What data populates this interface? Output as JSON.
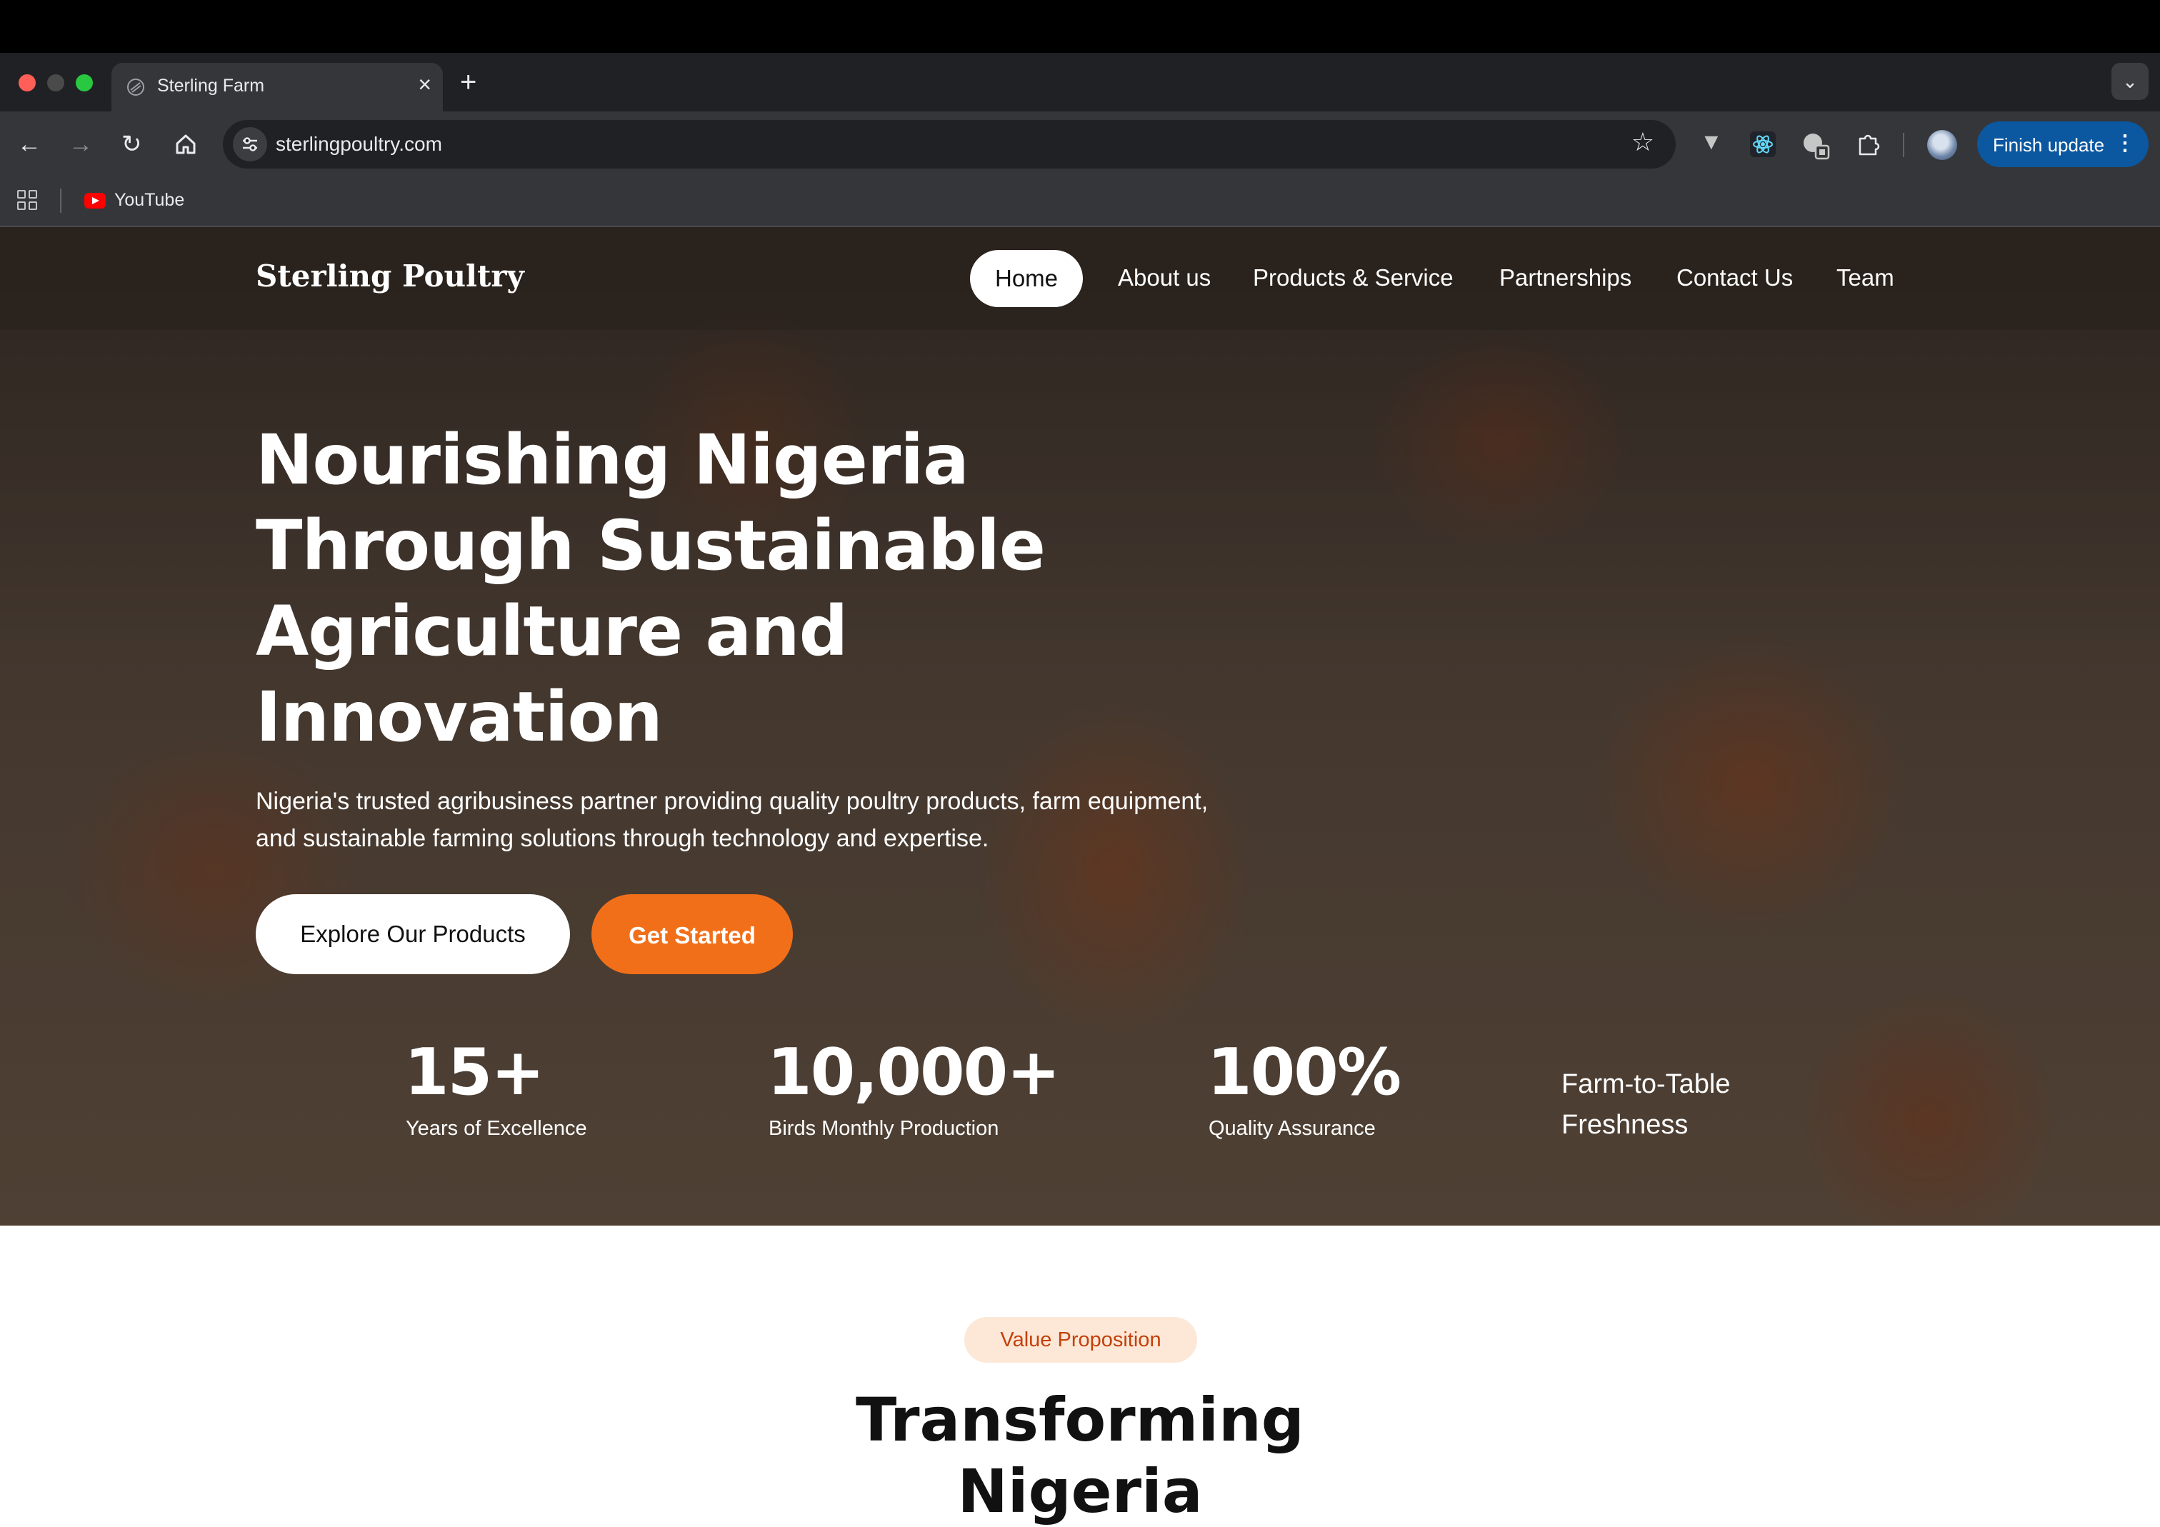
{
  "browser": {
    "tab_title": "Sterling Farm",
    "new_tab_symbol": "+",
    "url": "sterlingpoultry.com",
    "update_label": "Finish update",
    "bookmarks": [
      {
        "label": "YouTube"
      }
    ]
  },
  "site": {
    "brand": "Sterling Poultry",
    "nav": {
      "home": "Home",
      "about": "About us",
      "products": "Products & Service",
      "partnerships": "Partnerships",
      "contact": "Contact Us",
      "team": "Team"
    },
    "hero": {
      "title": "Nourishing Nigeria Through Sustainable Agriculture and Innovation",
      "subtitle": "Nigeria's trusted agribusiness partner providing quality poultry products, farm equipment, and sustainable farming solutions through technology and expertise.",
      "explore_label": "Explore Our Products",
      "start_label": "Get Started"
    },
    "stats": [
      {
        "value": "15+",
        "label": "Years of Excellence"
      },
      {
        "value": "10,000+",
        "label": "Birds Monthly Production"
      },
      {
        "value": "100%",
        "label": "Quality Assurance"
      },
      {
        "value": "",
        "label": "Farm-to-Table Freshness"
      }
    ],
    "value_section": {
      "pill": "Value Proposition",
      "heading": "Transforming Nigeria"
    }
  },
  "colors": {
    "accent": "#f26f1a",
    "update_button": "#0b57a0",
    "pill_bg": "#fde8d7",
    "pill_text": "#c2410c"
  }
}
